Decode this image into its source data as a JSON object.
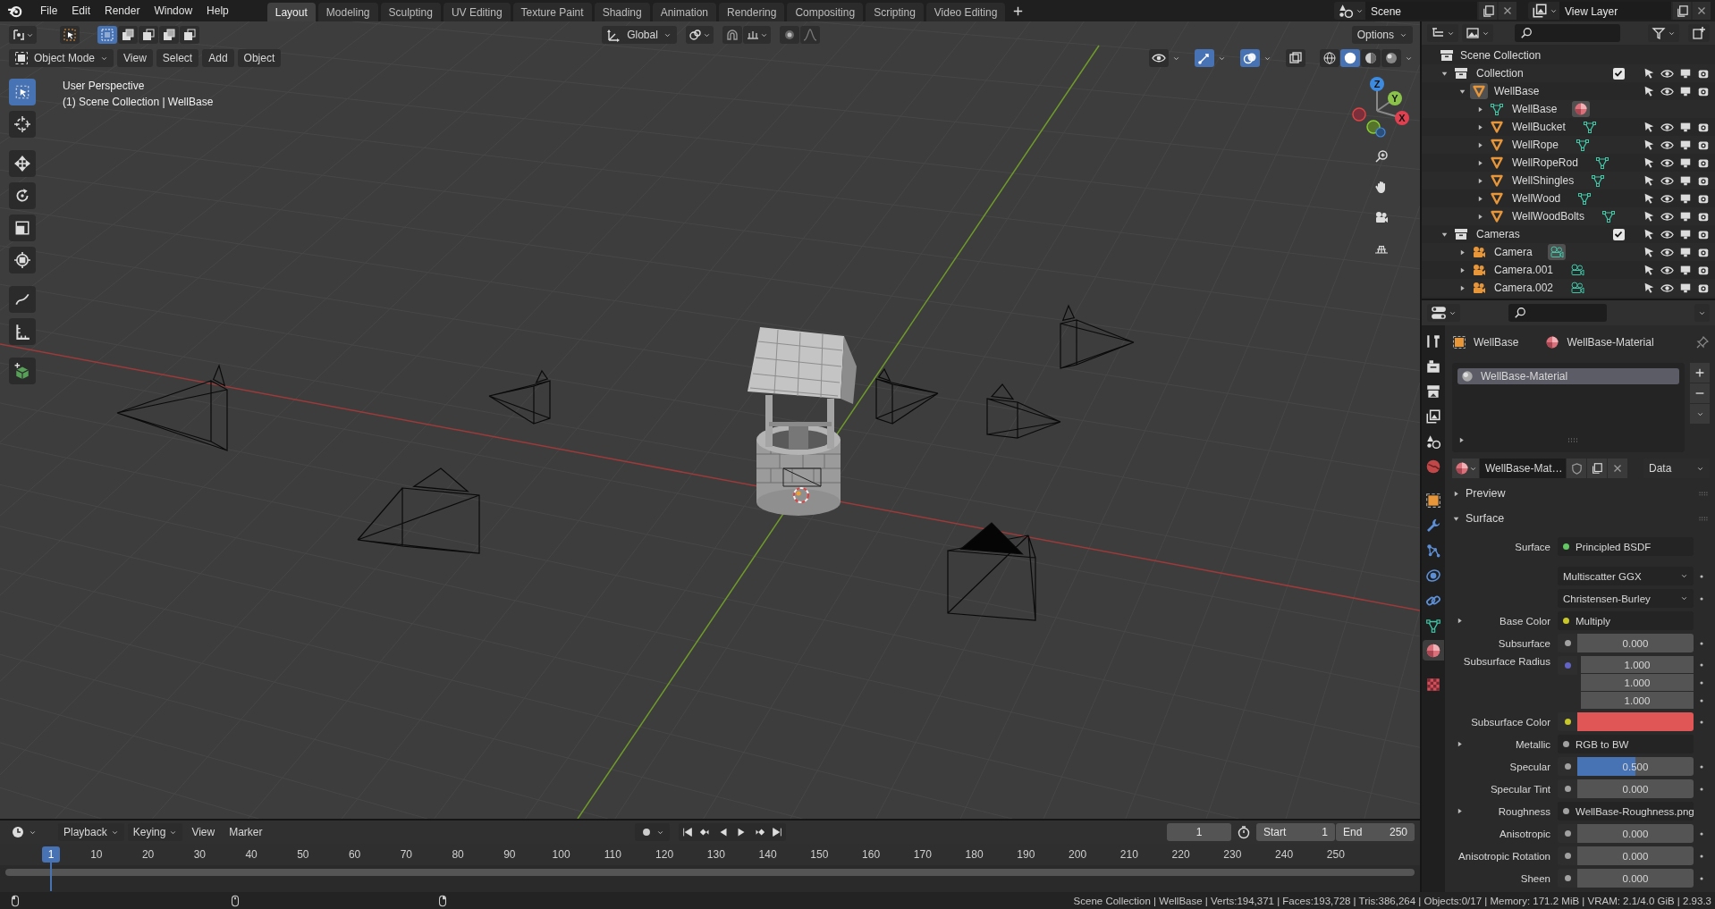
{
  "menu": [
    "File",
    "Edit",
    "Render",
    "Window",
    "Help"
  ],
  "workspaces": [
    {
      "label": "Layout",
      "selected": true
    },
    {
      "label": "Modeling",
      "selected": false
    },
    {
      "label": "Sculpting",
      "selected": false
    },
    {
      "label": "UV Editing",
      "selected": false
    },
    {
      "label": "Texture Paint",
      "selected": false
    },
    {
      "label": "Shading",
      "selected": false
    },
    {
      "label": "Animation",
      "selected": false
    },
    {
      "label": "Rendering",
      "selected": false
    },
    {
      "label": "Compositing",
      "selected": false
    },
    {
      "label": "Scripting",
      "selected": false
    },
    {
      "label": "Video Editing",
      "selected": false
    }
  ],
  "scene": "Scene",
  "view_layer": "View Layer",
  "viewport": {
    "orientation": "Global",
    "options": "Options",
    "mode": "Object Mode",
    "menus": [
      "View",
      "Select",
      "Add",
      "Object"
    ],
    "info": [
      "User Perspective",
      "(1) Scene Collection | WellBase"
    ],
    "select_modes": [
      {
        "selected": true
      },
      {
        "selected": false
      },
      {
        "selected": false
      },
      {
        "selected": false
      },
      {
        "selected": false
      }
    ],
    "toggles": [
      {
        "kind": "visibility",
        "on": false
      },
      {
        "kind": "gizmos",
        "on": true
      },
      {
        "kind": "overlays",
        "on": true
      },
      {
        "kind": "xray",
        "on": false
      }
    ],
    "shading": [
      {
        "kind": "wireframe",
        "selected": false
      },
      {
        "kind": "solid",
        "selected": true
      },
      {
        "kind": "material",
        "selected": false
      },
      {
        "kind": "rendered",
        "selected": false
      }
    ],
    "tools": [
      {
        "kind": "select",
        "selected": true
      },
      {
        "kind": "cursor",
        "selected": false
      },
      {
        "kind": "move",
        "selected": false
      },
      {
        "kind": "rotate",
        "selected": false
      },
      {
        "kind": "scale",
        "selected": false
      },
      {
        "kind": "transform",
        "selected": false
      },
      {
        "kind": "annotate",
        "selected": false
      },
      {
        "kind": "measure",
        "selected": false
      },
      {
        "kind": "add_cube",
        "selected": false
      }
    ],
    "gizmo_axes": [
      "X",
      "Y",
      "Z"
    ]
  },
  "outliner": {
    "root": "Scene Collection",
    "items": [
      {
        "name": "Collection",
        "kind": "collection",
        "expanded": true,
        "checked": true,
        "children": [
          {
            "name": "WellBase",
            "kind": "object",
            "expanded": true,
            "active": true,
            "children": [
              {
                "name": "WellBase",
                "kind": "mesh",
                "expanded": false,
                "active": true,
                "toggles": false
              },
              {
                "name": "WellBucket",
                "kind": "object",
                "expanded": false,
                "active": false,
                "toggles": true
              },
              {
                "name": "WellRope",
                "kind": "object",
                "expanded": false,
                "active": false,
                "toggles": true
              },
              {
                "name": "WellRopeRod",
                "kind": "object",
                "expanded": false,
                "active": false,
                "toggles": true
              },
              {
                "name": "WellShingles",
                "kind": "object",
                "expanded": false,
                "active": false,
                "toggles": true
              },
              {
                "name": "WellWood",
                "kind": "object",
                "expanded": false,
                "active": false,
                "toggles": true
              },
              {
                "name": "WellWoodBolts",
                "kind": "object",
                "expanded": false,
                "active": false,
                "toggles": true
              }
            ]
          }
        ]
      },
      {
        "name": "Cameras",
        "kind": "collection",
        "expanded": true,
        "checked": true,
        "children": [
          {
            "name": "Camera",
            "kind": "camera",
            "expanded": false,
            "active": true,
            "toggles": true
          },
          {
            "name": "Camera.001",
            "kind": "camera",
            "expanded": false,
            "active": false,
            "toggles": true
          },
          {
            "name": "Camera.002",
            "kind": "camera",
            "expanded": false,
            "active": false,
            "toggles": true
          }
        ]
      }
    ]
  },
  "properties": {
    "tabs": [
      {
        "kind": "tool",
        "selected": false
      },
      {
        "kind": "render",
        "selected": false
      },
      {
        "kind": "output",
        "selected": false
      },
      {
        "kind": "view_layer",
        "selected": false
      },
      {
        "kind": "scene",
        "selected": false
      },
      {
        "kind": "world",
        "selected": false
      },
      {
        "kind": "object",
        "selected": false
      },
      {
        "kind": "modifier",
        "selected": false
      },
      {
        "kind": "particles",
        "selected": false
      },
      {
        "kind": "physics",
        "selected": false
      },
      {
        "kind": "constraint",
        "selected": false
      },
      {
        "kind": "data",
        "selected": false
      },
      {
        "kind": "material",
        "selected": true
      },
      {
        "kind": "texture",
        "selected": false
      }
    ],
    "breadcrumb": [
      "WellBase",
      "WellBase-Material"
    ],
    "slots": [
      {
        "name": "WellBase-Material",
        "selected": true
      }
    ],
    "material": "WellBase-Mat…",
    "link": "Data",
    "panels": [
      {
        "title": "Preview",
        "expanded": false
      },
      {
        "title": "Surface",
        "expanded": true
      }
    ],
    "rows": [
      {
        "kind": "link",
        "label": "Surface",
        "expandable": false,
        "color": "#63c763",
        "value": "Principled BSDF"
      },
      {
        "kind": "dropdown",
        "value": "Multiscatter GGX"
      },
      {
        "kind": "dropdown",
        "value": "Christensen-Burley"
      },
      {
        "kind": "link",
        "label": "Base Color",
        "expandable": true,
        "color": "#c7c729",
        "value": "Multiply"
      },
      {
        "kind": "slider",
        "label": "Subsurface",
        "color": "#a1a1a1",
        "value": "0.000",
        "level": 0
      },
      {
        "kind": "vector",
        "label": "Subsurface Radius",
        "color": "#6363c7",
        "values": [
          "1.000",
          "1.000",
          "1.000"
        ]
      },
      {
        "kind": "color",
        "label": "Subsurface Color",
        "color": "#c7c729",
        "swatch": {
          "color": "#e05656"
        }
      },
      {
        "kind": "link",
        "label": "Metallic",
        "expandable": true,
        "color": "#a1a1a1",
        "value": "RGB to BW"
      },
      {
        "kind": "slider",
        "label": "Specular",
        "color": "#a1a1a1",
        "value": "0.500",
        "level": 0.5
      },
      {
        "kind": "slider",
        "label": "Specular Tint",
        "color": "#a1a1a1",
        "value": "0.000",
        "level": 0
      },
      {
        "kind": "link",
        "label": "Roughness",
        "expandable": true,
        "color": "#a1a1a1",
        "value": "WellBase-Roughness.png"
      },
      {
        "kind": "slider",
        "label": "Anisotropic",
        "color": "#a1a1a1",
        "value": "0.000",
        "level": 0
      },
      {
        "kind": "slider",
        "label": "Anisotropic Rotation",
        "color": "#a1a1a1",
        "value": "0.000",
        "level": 0
      },
      {
        "kind": "slider",
        "label": "Sheen",
        "color": "#a1a1a1",
        "value": "0.000",
        "level": 0
      }
    ]
  },
  "timeline": {
    "menus": [
      {
        "label": "Playback",
        "dropdown": true
      },
      {
        "label": "Keying",
        "dropdown": true
      },
      {
        "label": "View",
        "dropdown": false
      },
      {
        "label": "Marker",
        "dropdown": false
      }
    ],
    "frame": "1",
    "start_label": "Start",
    "start": "1",
    "end_label": "End",
    "end": "250",
    "playhead": "1",
    "ruler": [
      "10",
      "20",
      "30",
      "40",
      "50",
      "60",
      "70",
      "80",
      "90",
      "100",
      "110",
      "120",
      "130",
      "140",
      "150",
      "160",
      "170",
      "180",
      "190",
      "200",
      "210",
      "220",
      "230",
      "240",
      "250"
    ]
  },
  "status": {
    "info": "Scene Collection | WellBase | Verts:194,371 | Faces:193,728 | Tris:386,264 | Objects:0/17 | Memory: 171.2 MiB | VRAM: 2.1/4.0 GiB | 2.93.3"
  }
}
